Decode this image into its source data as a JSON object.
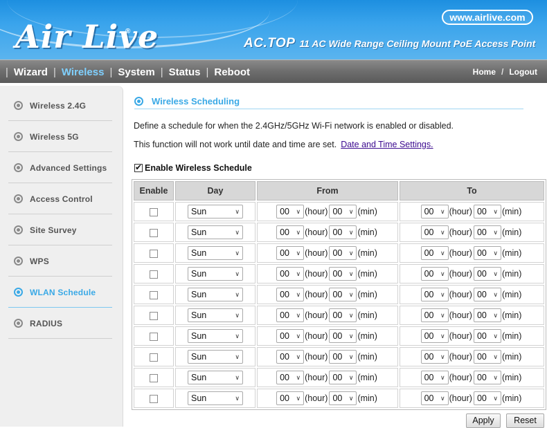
{
  "header": {
    "logo": "Air Live",
    "logo_mark": "®",
    "url": "www.airlive.com",
    "model": "AC.TOP",
    "description": "11 AC Wide Range Ceiling Mount PoE Access Point"
  },
  "nav": {
    "items": [
      "Wizard",
      "Wireless",
      "System",
      "Status",
      "Reboot"
    ],
    "active": "Wireless",
    "separator": "|",
    "home": "Home",
    "slash": "/",
    "logout": "Logout"
  },
  "sidebar": {
    "items": [
      {
        "label": "Wireless 2.4G",
        "active": false
      },
      {
        "label": "Wireless 5G",
        "active": false
      },
      {
        "label": "Advanced Settings",
        "active": false
      },
      {
        "label": "Access Control",
        "active": false
      },
      {
        "label": "Site Survey",
        "active": false
      },
      {
        "label": "WPS",
        "active": false
      },
      {
        "label": "WLAN Schedule",
        "active": true
      },
      {
        "label": "RADIUS",
        "active": false
      }
    ]
  },
  "main": {
    "title": "Wireless Scheduling",
    "desc1": "Define a schedule for when the 2.4GHz/5GHz Wi-Fi network is enabled or disabled.",
    "desc2": "This function will not work until date and time are set.",
    "desc2_link": "Date and Time Settings.",
    "enable_label": "Enable Wireless Schedule",
    "enable_checked": true
  },
  "table": {
    "headers": [
      "Enable",
      "Day",
      "From",
      "To"
    ],
    "hour_unit": "(hour)",
    "min_unit": "(min)",
    "rows": [
      {
        "enabled": false,
        "day": "Sun",
        "from_hour": "00",
        "from_min": "00",
        "to_hour": "00",
        "to_min": "00"
      },
      {
        "enabled": false,
        "day": "Sun",
        "from_hour": "00",
        "from_min": "00",
        "to_hour": "00",
        "to_min": "00"
      },
      {
        "enabled": false,
        "day": "Sun",
        "from_hour": "00",
        "from_min": "00",
        "to_hour": "00",
        "to_min": "00"
      },
      {
        "enabled": false,
        "day": "Sun",
        "from_hour": "00",
        "from_min": "00",
        "to_hour": "00",
        "to_min": "00"
      },
      {
        "enabled": false,
        "day": "Sun",
        "from_hour": "00",
        "from_min": "00",
        "to_hour": "00",
        "to_min": "00"
      },
      {
        "enabled": false,
        "day": "Sun",
        "from_hour": "00",
        "from_min": "00",
        "to_hour": "00",
        "to_min": "00"
      },
      {
        "enabled": false,
        "day": "Sun",
        "from_hour": "00",
        "from_min": "00",
        "to_hour": "00",
        "to_min": "00"
      },
      {
        "enabled": false,
        "day": "Sun",
        "from_hour": "00",
        "from_min": "00",
        "to_hour": "00",
        "to_min": "00"
      },
      {
        "enabled": false,
        "day": "Sun",
        "from_hour": "00",
        "from_min": "00",
        "to_hour": "00",
        "to_min": "00"
      },
      {
        "enabled": false,
        "day": "Sun",
        "from_hour": "00",
        "from_min": "00",
        "to_hour": "00",
        "to_min": "00"
      }
    ]
  },
  "buttons": {
    "apply": "Apply",
    "reset": "Reset"
  },
  "colors": {
    "header_blue": "#2e9be6",
    "accent": "#3aa9e6",
    "nav_active": "#7fd0ff",
    "link": "#3b0a8f"
  }
}
